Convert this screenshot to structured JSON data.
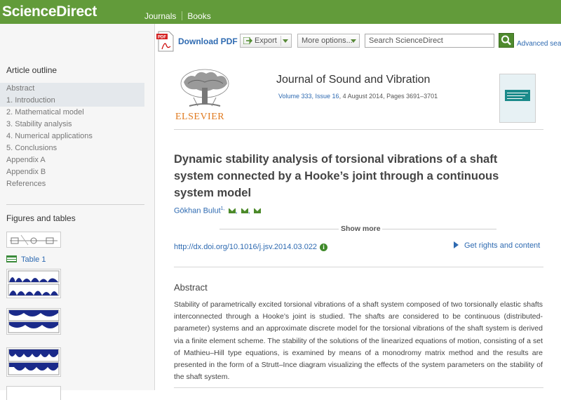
{
  "header": {
    "logo": "ScienceDirect",
    "nav": [
      "Journals",
      "Books"
    ]
  },
  "toolbar": {
    "download_pdf": "Download PDF",
    "export_label": "Export",
    "more_options": "More options...",
    "search_placeholder": "Search ScienceDirect",
    "advanced_search": "Advanced sear"
  },
  "sidebar": {
    "outline_title": "Article outline",
    "outline_items": [
      "Abstract",
      "1. Introduction",
      "2. Mathematical model",
      "3. Stability analysis",
      "4. Numerical applications",
      "5. Conclusions",
      "Appendix A",
      "Appendix B",
      "References"
    ],
    "figures_title": "Figures and tables",
    "table_link": "Table 1"
  },
  "journal": {
    "publisher": "ELSEVIER",
    "title": "Journal of Sound and Vibration",
    "volume": "Volume 333, Issue 16",
    "date_pages": ", 4 August 2014, Pages 3691–3701"
  },
  "article": {
    "title": "Dynamic stability analysis of torsional vibrations of a shaft system connected by a Hooke’s joint through a continuous system model",
    "author": "Gökhan Bulut",
    "author_sup": "1,",
    "show_more": "Show more",
    "doi": "http://dx.doi.org/10.1016/j.jsv.2014.03.022",
    "rights": "Get rights and content",
    "abstract_heading": "Abstract",
    "abstract_text": "Stability of parametrically excited torsional vibrations of a shaft system composed of two torsionally elastic shafts interconnected through a Hooke’s joint is studied. The shafts are considered to be continuous (distributed-parameter) systems and an approximate discrete model for the torsional vibrations of the shaft system is derived via a finite element scheme. The stability of the solutions of the linearized equations of motion, consisting of a set of Mathieu–Hill type equations, is examined by means of a monodromy matrix method and the results are presented in the form of a Strutt–Ince diagram visualizing the effects of the system parameters on the stability of the shaft system."
  },
  "colors": {
    "brand_green": "#629b3a",
    "link_blue": "#2e6ab1",
    "elsevier_orange": "#e07a1f"
  }
}
